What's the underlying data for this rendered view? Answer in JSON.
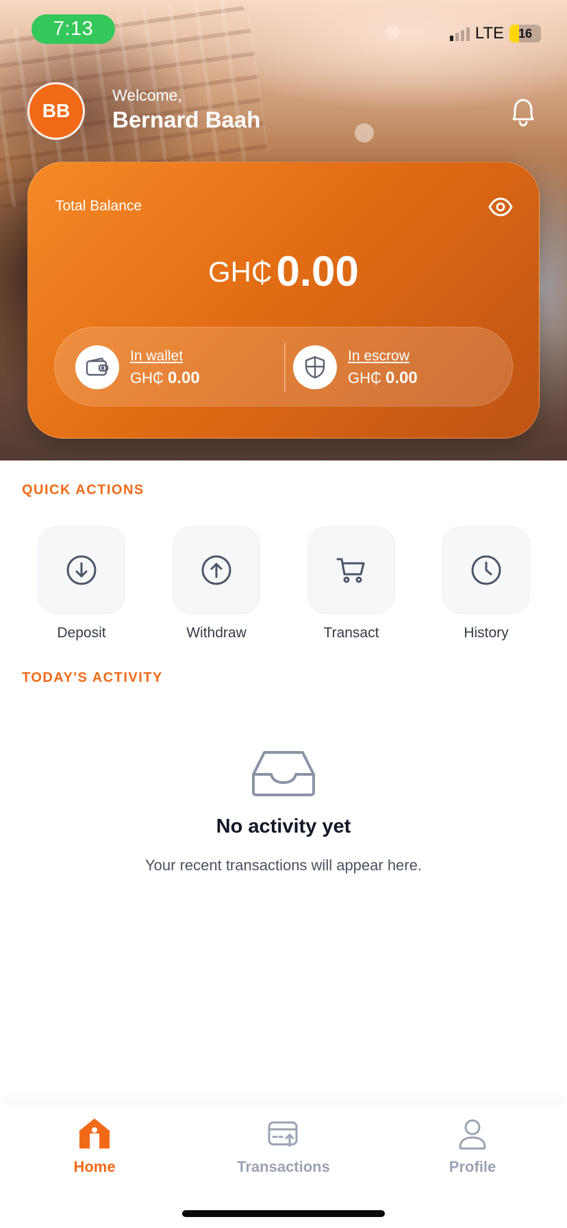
{
  "status_bar": {
    "time": "7:13",
    "network": "LTE",
    "battery": "16"
  },
  "header": {
    "avatar_initials": "BB",
    "welcome": "Welcome,",
    "user_name": "Bernard Baah"
  },
  "balance_card": {
    "label": "Total Balance",
    "currency": "GH₵",
    "total": "0.00",
    "wallet": {
      "label": "In wallet",
      "currency": "GH₵",
      "amount": "0.00"
    },
    "escrow": {
      "label": "In escrow",
      "currency": "GH₵",
      "amount": "0.00"
    }
  },
  "quick_actions": {
    "title": "QUICK ACTIONS",
    "items": [
      {
        "label": "Deposit",
        "icon": "arrow-down-circle-icon"
      },
      {
        "label": "Withdraw",
        "icon": "arrow-up-circle-icon"
      },
      {
        "label": "Transact",
        "icon": "shopping-cart-icon"
      },
      {
        "label": "History",
        "icon": "clock-icon"
      }
    ]
  },
  "activity": {
    "title": "TODAY'S ACTIVITY",
    "empty_title": "No activity yet",
    "empty_subtitle": "Your recent transactions will appear here."
  },
  "bottom_nav": {
    "items": [
      {
        "label": "Home",
        "icon": "home-icon",
        "active": true
      },
      {
        "label": "Transactions",
        "icon": "transactions-card-icon",
        "active": false
      },
      {
        "label": "Profile",
        "icon": "user-icon",
        "active": false
      }
    ]
  },
  "colors": {
    "accent": "#f26a18",
    "status_green": "#34c759",
    "card_gradient_start": "#f58a27",
    "card_gradient_end": "#bd5314",
    "icon_gray": "#4a5568",
    "nav_inactive": "#9aa3b2"
  }
}
